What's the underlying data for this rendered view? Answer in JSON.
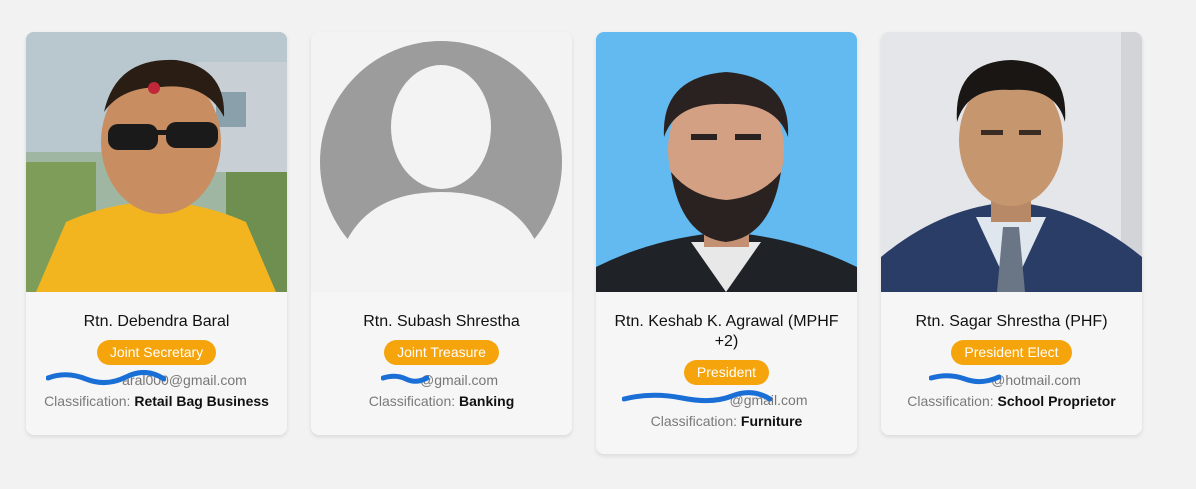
{
  "members": [
    {
      "name": "Rtn. Debendra Baral",
      "role": "Joint Secretary",
      "email": "aral000@gmail.com",
      "classification_label": "Classification:",
      "classification": "Retail Bag Business"
    },
    {
      "name": "Rtn. Subash Shrestha",
      "role": "Joint Treasure",
      "email": "@gmail.com",
      "classification_label": "Classification:",
      "classification": "Banking"
    },
    {
      "name": "Rtn. Keshab K. Agrawal (MPHF +2)",
      "role": "President",
      "email": "@gmail.com",
      "classification_label": "Classification:",
      "classification": "Furniture"
    },
    {
      "name": "Rtn. Sagar Shrestha (PHF)",
      "role": "President Elect",
      "email": "@hotmail.com",
      "classification_label": "Classification:",
      "classification": "School Proprietor"
    }
  ],
  "colors": {
    "badge": "#f5a40c",
    "page_bg": "#f2f2f2",
    "card_bg": "#f6f6f6",
    "redaction": "#1a6fd6"
  }
}
